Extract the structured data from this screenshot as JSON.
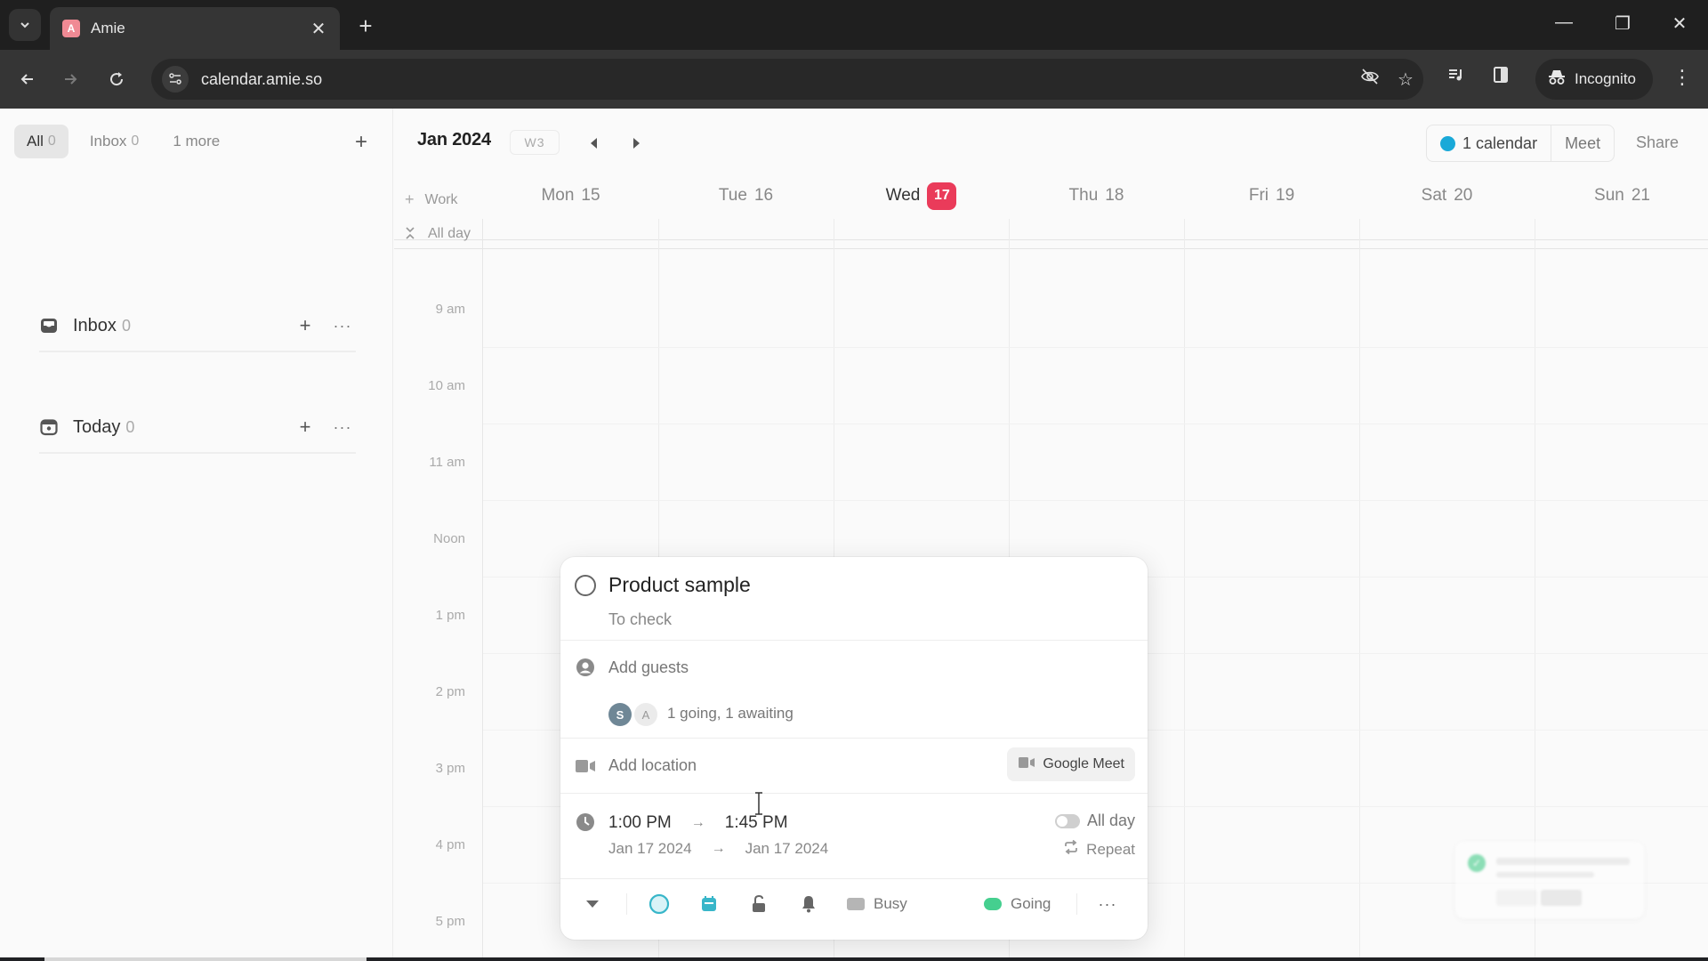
{
  "browser": {
    "tab_title": "Amie",
    "tab_favicon_letter": "A",
    "url": "calendar.amie.so",
    "incognito_label": "Incognito",
    "icons": {
      "tab_search": "chevron-down-icon",
      "close_tab": "close-icon",
      "new_tab": "plus-icon",
      "back": "arrow-left-icon",
      "forward": "arrow-right-icon",
      "reload": "reload-icon",
      "site_info": "tune-icon",
      "eye_off": "eye-off-icon",
      "bookmark": "star-icon",
      "media": "playlist-icon",
      "side_panel": "side-panel-icon",
      "incognito": "incognito-icon",
      "menu": "kebab-icon",
      "minimize": "minimize-icon",
      "restore": "restore-icon",
      "close_window": "close-icon"
    }
  },
  "sidebar": {
    "filter_tabs": [
      {
        "label": "All",
        "count": "0",
        "active": true
      },
      {
        "label": "Inbox",
        "count": "0",
        "active": false
      },
      {
        "label": "1 more",
        "count": "",
        "active": false
      }
    ],
    "sections": [
      {
        "name": "Inbox",
        "count": "0",
        "icon": "inbox-icon"
      },
      {
        "name": "Today",
        "count": "0",
        "icon": "calendar-today-icon"
      }
    ],
    "more_glyph": "···"
  },
  "calendar": {
    "month": "Jan 2024",
    "week_badge": "W3",
    "calendars_label": "1 calendar",
    "calendar_color": "#1aa9d8",
    "meet_label": "Meet",
    "share_label": "Share",
    "work_label": "Work",
    "all_day_label": "All day",
    "days": [
      {
        "name": "Mon",
        "date": "15",
        "today": false
      },
      {
        "name": "Tue",
        "date": "16",
        "today": false
      },
      {
        "name": "Wed",
        "date": "17",
        "today": true
      },
      {
        "name": "Thu",
        "date": "18",
        "today": false
      },
      {
        "name": "Fri",
        "date": "19",
        "today": false
      },
      {
        "name": "Sat",
        "date": "20",
        "today": false
      },
      {
        "name": "Sun",
        "date": "21",
        "today": false
      }
    ],
    "today_color": "#ea3b5a",
    "hours": [
      "9 am",
      "10 am",
      "11 am",
      "Noon",
      "1 pm",
      "2 pm",
      "3 pm",
      "4 pm",
      "5 pm"
    ]
  },
  "event_popup": {
    "title": "Product sample",
    "subtitle": "To check",
    "add_guests_label": "Add guests",
    "guests": [
      {
        "initial": "S",
        "status": "going"
      },
      {
        "initial": "A",
        "status": "awaiting"
      }
    ],
    "guests_summary": "1 going, 1 awaiting",
    "add_location_label": "Add location",
    "google_meet_label": "Google Meet",
    "start_time": "1:00 PM",
    "end_time": "1:45 PM",
    "start_date": "Jan 17 2024",
    "end_date": "Jan 17 2024",
    "arrow_glyph": "→",
    "all_day_label": "All day",
    "all_day_enabled": false,
    "repeat_label": "Repeat",
    "busy_label": "Busy",
    "going_label": "Going",
    "going_color": "#45cf8f",
    "event_color": "#38b6c9"
  }
}
